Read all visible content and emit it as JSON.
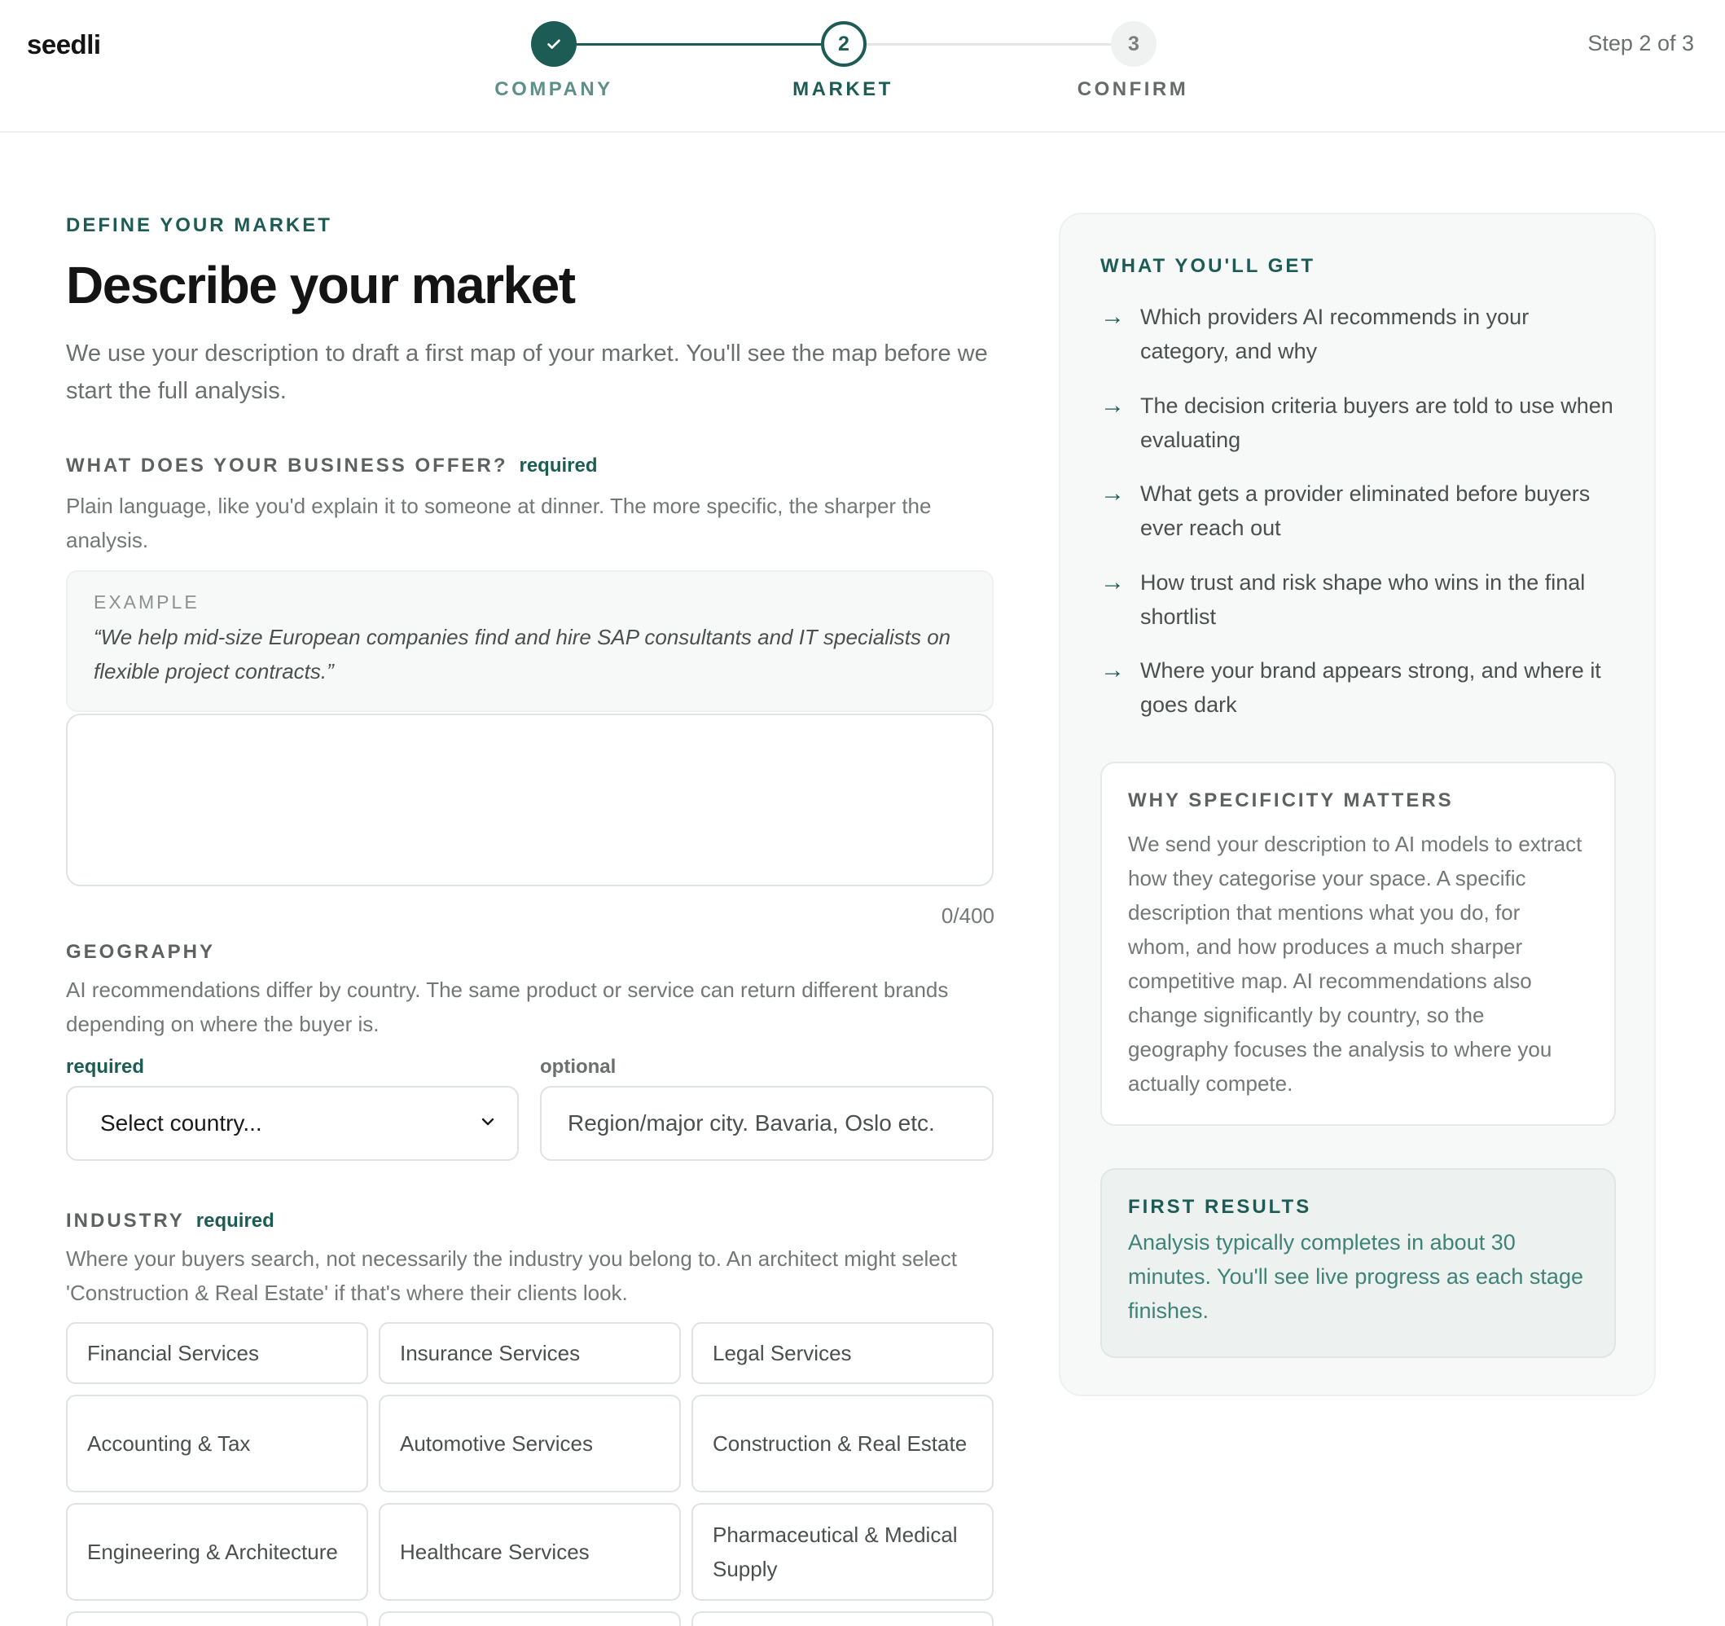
{
  "header": {
    "logo": "seedli",
    "step_count": "Step 2 of 3",
    "steps": [
      {
        "number": "✓",
        "label": "COMPANY",
        "state": "done"
      },
      {
        "number": "2",
        "label": "MARKET",
        "state": "active"
      },
      {
        "number": "3",
        "label": "CONFIRM",
        "state": "todo"
      }
    ]
  },
  "main": {
    "eyebrow": "DEFINE YOUR MARKET",
    "title": "Describe your market",
    "lead": "We use your description to draft a first map of your market. You'll see the map before we start the full analysis.",
    "offer": {
      "label": "WHAT DOES YOUR BUSINESS OFFER?",
      "required": "required",
      "help": "Plain language, like you'd explain it to someone at dinner. The more specific, the sharper the analysis.",
      "example_label": "EXAMPLE",
      "example_text": "“We help mid-size European companies find and hire SAP consultants and IT specialists on flexible project contracts.”",
      "value": "",
      "counter": "0/400"
    },
    "geography": {
      "label": "GEOGRAPHY",
      "help": "AI recommendations differ by country. The same product or service can return different brands depending on where the buyer is.",
      "country_label": "required",
      "country_value": "Select country...",
      "region_label": "optional",
      "region_placeholder": "Region/major city. Bavaria, Oslo etc."
    },
    "industry": {
      "label": "INDUSTRY",
      "required": "required",
      "help": "Where your buyers search, not necessarily the industry you belong to. An architect might select 'Construction & Real Estate' if that's where their clients look.",
      "options": [
        "Financial Services",
        "Insurance Services",
        "Legal Services",
        "Accounting & Tax",
        "Automotive Services",
        "Construction & Real Estate",
        "Engineering & Architecture",
        "Healthcare Services",
        "Pharmaceutical & Medical Supply"
      ]
    }
  },
  "aside": {
    "title": "WHAT YOU'LL GET",
    "benefits": [
      "Which providers AI recommends in your category, and why",
      "The decision criteria buyers are told to use when evaluating",
      "What gets a provider eliminated before buyers ever reach out",
      "How trust and risk shape who wins in the final shortlist",
      "Where your brand appears strong, and where it goes dark"
    ],
    "why_title": "WHY SPECIFICITY MATTERS",
    "why_text": "We send your description to AI models to extract how they categorise your space. A specific description that mentions what you do, for whom, and how produces a much sharper competitive map. AI recommendations also change significantly by country, so the geography focuses the analysis to where you actually compete.",
    "first_title": "FIRST RESULTS",
    "first_text": "Analysis typically completes in about 30 minutes. You'll see live progress as each stage finishes."
  },
  "colors": {
    "accent": "#1d5c54",
    "muted_text": "#737776",
    "border": "#dfe3e2"
  }
}
